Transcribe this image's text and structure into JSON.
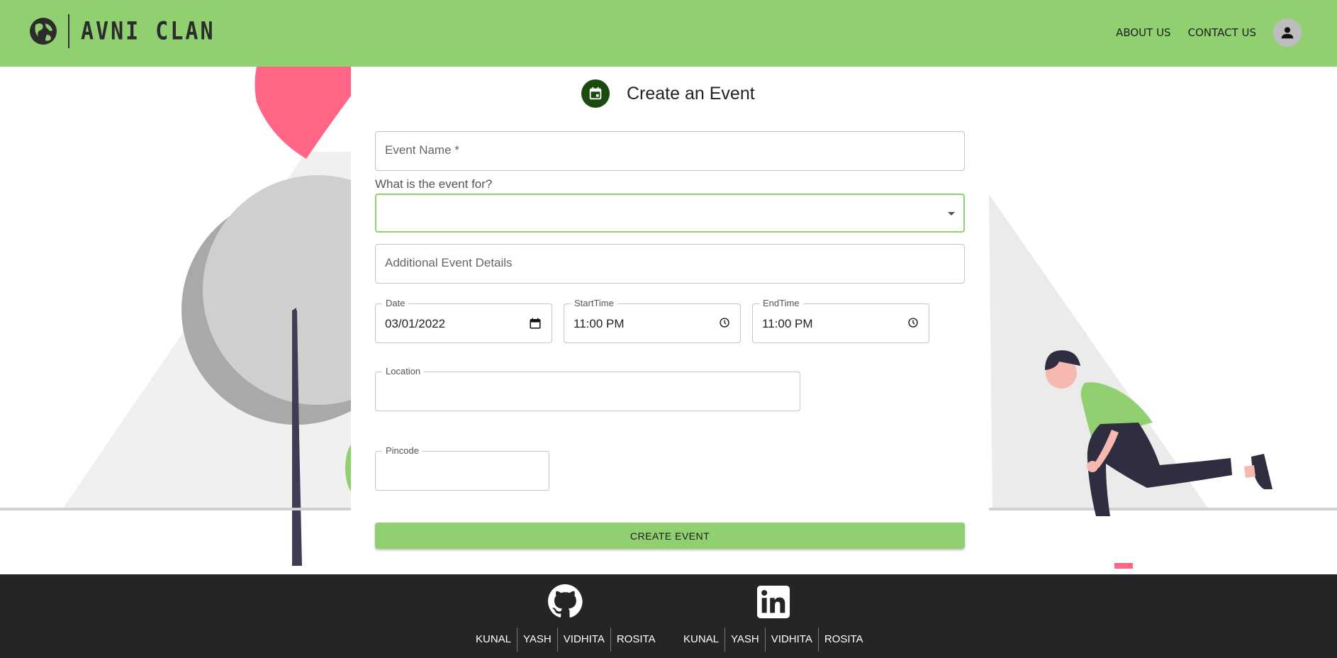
{
  "header": {
    "brand": "AVNI CLAN",
    "nav": [
      "ABOUT US",
      "CONTACT US"
    ],
    "colors": {
      "bar": "#90d070"
    }
  },
  "form": {
    "title": "Create an Event",
    "event_name_placeholder": "Event Name *",
    "event_for_label": "What is the event for?",
    "event_for_value": "",
    "details_placeholder": "Additional Event Details",
    "date_label": "Date",
    "date_value": "03/01/2022",
    "start_label": "StartTime",
    "start_value": "11:00 PM",
    "end_label": "EndTime",
    "end_value": "11:00 PM",
    "location_label": "Location",
    "location_value": "",
    "pincode_label": "Pincode",
    "pincode_value": "",
    "submit_label": "CREATE EVENT"
  },
  "footer": {
    "github_names": [
      "KUNAL",
      "YASH",
      "VIDHITA",
      "ROSITA"
    ],
    "linkedin_names": [
      "KUNAL",
      "YASH",
      "VIDHITA",
      "ROSITA"
    ]
  }
}
